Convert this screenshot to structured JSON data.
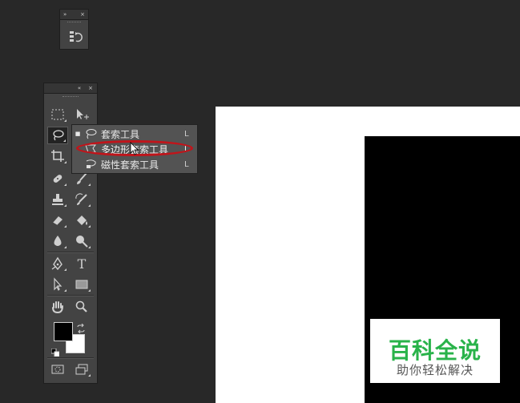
{
  "history_panel": {
    "collapse_glyph": "»",
    "close_glyph": "×"
  },
  "toolbox": {
    "expand_glyph": "«",
    "close_glyph": "×",
    "tools": [
      {
        "name": "rectangular-marquee-icon"
      },
      {
        "name": "move-tool-icon"
      },
      {
        "name": "lasso-icon"
      },
      {
        "name": "quick-selection-icon"
      },
      {
        "name": "crop-icon"
      },
      {
        "name": "eyedropper-icon"
      },
      {
        "name": "healing-brush-icon"
      },
      {
        "name": "brush-icon"
      },
      {
        "name": "clone-stamp-icon"
      },
      {
        "name": "history-brush-icon"
      },
      {
        "name": "eraser-icon"
      },
      {
        "name": "paint-bucket-icon"
      },
      {
        "name": "blur-icon"
      },
      {
        "name": "dodge-icon"
      },
      {
        "name": "pen-icon"
      },
      {
        "name": "type-icon"
      },
      {
        "name": "path-selection-icon"
      },
      {
        "name": "rectangle-shape-icon"
      },
      {
        "name": "hand-icon"
      },
      {
        "name": "zoom-icon"
      },
      {
        "name": "quick-mask-icon"
      },
      {
        "name": "screen-mode-icon"
      }
    ],
    "type_glyph": "T",
    "foreground_color": "#000000",
    "background_color": "#ffffff"
  },
  "flyout": {
    "items": [
      {
        "label": "套索工具",
        "shortcut": "L",
        "selected": true
      },
      {
        "label": "多边形套索工具",
        "shortcut": "L",
        "selected": false
      },
      {
        "label": "磁性套索工具",
        "shortcut": "L",
        "selected": false
      }
    ],
    "bullet": "■",
    "highlight_color": "#c1141a"
  },
  "watermark": {
    "title": "百科全说",
    "subtitle": "助你轻松解决",
    "title_color": "#29b34a"
  }
}
